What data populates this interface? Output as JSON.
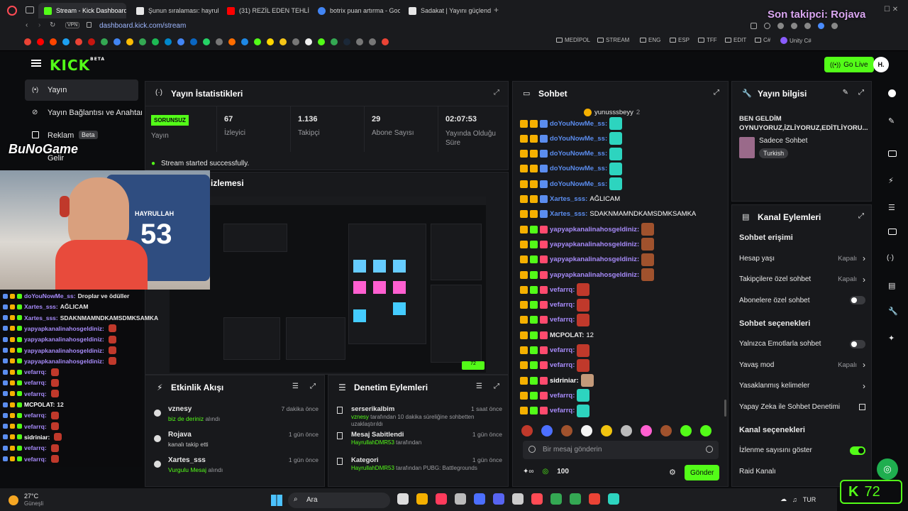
{
  "browser": {
    "tabs": [
      {
        "label": "Stream - Kick Dashboard",
        "color": "#53fc18"
      },
      {
        "label": "Şunun sıralaması: hayrulla...",
        "color": "#e6e6e6"
      },
      {
        "label": "(31) REZİL EDEN TEHLİKE...",
        "color": "#ff0000"
      },
      {
        "label": "botrix puan artırma - Goog...",
        "color": "#4285f4"
      },
      {
        "label": "Sadakat | Yayını güçlendi...",
        "color": "#e6e6e6"
      }
    ],
    "url": "dashboard.kick.com/stream",
    "vpn": "VPN",
    "bookmarks": [
      "MEDİPOL",
      "STREAM",
      "ENG",
      "ESP",
      "TFF",
      "EDIT",
      "C#",
      "Unity C#"
    ]
  },
  "overlay": {
    "last_follower": "Son takipci: Rojava",
    "brand": "BuNoGame",
    "webcam_jersey_name": "HAYRULLAH",
    "webcam_jersey_number": "53",
    "stream_chat": [
      {
        "user": "doYouNowMe_ss:",
        "msg": "Droplar ve ödüller"
      },
      {
        "user": "Xartes_sss:",
        "msg": "AĞLICAM"
      },
      {
        "user": "Xartes_sss:",
        "msg": "SDAKNMAMNDKAMSDMKSAMKA"
      },
      {
        "user": "yapyapkanalinahosgeldiniz:",
        "msg": ""
      },
      {
        "user": "yapyapkanalinahosgeldiniz:",
        "msg": ""
      },
      {
        "user": "yapyapkanalinahosgeldiniz:",
        "msg": ""
      },
      {
        "user": "yapyapkanalinahosgeldiniz:",
        "msg": ""
      },
      {
        "user": "vefarrq:",
        "msg": ""
      },
      {
        "user": "vefarrq:",
        "msg": ""
      },
      {
        "user": "vefarrq:",
        "msg": ""
      },
      {
        "user": "MCPOLAT:",
        "msg": "12"
      },
      {
        "user": "vefarrq:",
        "msg": ""
      },
      {
        "user": "vefarrq:",
        "msg": ""
      },
      {
        "user": "sidriniar:",
        "msg": ""
      },
      {
        "user": "vefarrq:",
        "msg": ""
      },
      {
        "user": "vefarrq:",
        "msg": ""
      }
    ],
    "viewer_count": "72"
  },
  "nav": {
    "items": [
      {
        "label": "Yayın"
      },
      {
        "label": "Yayın Bağlantısı ve Anahtarı"
      },
      {
        "label": "Reklam",
        "badge": "Beta"
      },
      {
        "label": "Gelir"
      }
    ],
    "go_live": "Go Live",
    "avatar": "H."
  },
  "stats": {
    "title": "Yayın İstatistikleri",
    "items": [
      {
        "value": "SORUNSUZ",
        "label": "Yayın"
      },
      {
        "value": "67",
        "label": "İzleyici"
      },
      {
        "value": "1.136",
        "label": "Takipçi"
      },
      {
        "value": "29",
        "label": "Abone Sayısı"
      },
      {
        "value": "02:07:53",
        "label": "Yayında Olduğu Süre"
      }
    ],
    "status_message": "Stream started successfully.",
    "preview_title": "Yayın Önizlemesi",
    "preview_title_visible": "izlemesi"
  },
  "activity": {
    "title": "Etkinlik Akışı",
    "events": [
      {
        "user": "vznesy",
        "desc": "biz de deriniz",
        "suffix": "alındı",
        "time": "7 dakika önce"
      },
      {
        "user": "Rojava",
        "desc": "kanalı takip etti",
        "suffix": "",
        "time": "1 gün önce"
      },
      {
        "user": "Xartes_sss",
        "desc": "Vurgulu Mesaj",
        "suffix": "alındı",
        "time": "1 gün önce"
      }
    ]
  },
  "moderation": {
    "title": "Denetim Eylemleri",
    "events": [
      {
        "title": "serserikalbim",
        "line1": "vznesy",
        "line1b": "tarafından 10 dakika süreliğine sohbetten uzaklaştırıldı",
        "time": "1 saat önce"
      },
      {
        "title": "Mesaj Sabitlendi",
        "line1": "HayrullahDMR53",
        "line1b": "tarafından",
        "time": "1 gün önce"
      },
      {
        "title": "Kategori",
        "line1": "HayrullahDMR53",
        "line1b": "tarafından PUBG: Battlegrounds",
        "time": "1 gün önce"
      }
    ]
  },
  "chat": {
    "title": "Sohbet",
    "pinned_user": "yunusssbeyy",
    "pinned_count": "2",
    "messages": [
      {
        "user": "doYouNowMe_ss:",
        "text": "",
        "color": "#5b8def"
      },
      {
        "user": "doYouNowMe_ss:",
        "text": "",
        "color": "#5b8def"
      },
      {
        "user": "doYouNowMe_ss:",
        "text": "",
        "color": "#5b8def"
      },
      {
        "user": "doYouNowMe_ss:",
        "text": "",
        "color": "#5b8def"
      },
      {
        "user": "doYouNowMe_ss:",
        "text": "",
        "color": "#5b8def"
      },
      {
        "user": "Xartes_sss:",
        "text": "AĞLICAM",
        "color": "#5b8def"
      },
      {
        "user": "Xartes_sss:",
        "text": "SDAKNMAMNDKAMSDMKSAMKA",
        "color": "#5b8def"
      },
      {
        "user": "yapyapkanalinahosgeldiniz:",
        "text": "",
        "color": "#a78bfa"
      },
      {
        "user": "yapyapkanalinahosgeldiniz:",
        "text": "",
        "color": "#a78bfa"
      },
      {
        "user": "yapyapkanalinahosgeldiniz:",
        "text": "",
        "color": "#a78bfa"
      },
      {
        "user": "yapyapkanalinahosgeldiniz:",
        "text": "",
        "color": "#a78bfa"
      },
      {
        "user": "vefarrq:",
        "text": "",
        "color": "#a78bfa"
      },
      {
        "user": "vefarrq:",
        "text": "",
        "color": "#a78bfa"
      },
      {
        "user": "vefarrq:",
        "text": "",
        "color": "#a78bfa"
      },
      {
        "user": "MCPOLAT:",
        "text": "12",
        "color": "#e8e8e8"
      },
      {
        "user": "vefarrq:",
        "text": "",
        "color": "#a78bfa"
      },
      {
        "user": "vefarrq:",
        "text": "",
        "color": "#a78bfa"
      },
      {
        "user": "sidriniar:",
        "text": "",
        "color": "#ffffff"
      },
      {
        "user": "vefarrq:",
        "text": "",
        "color": "#a78bfa"
      },
      {
        "user": "vefarrq:",
        "text": "",
        "color": "#a78bfa"
      }
    ],
    "input_placeholder": "Bir mesaj gönderin",
    "points": "100",
    "send": "Gönder"
  },
  "stream_info": {
    "title": "Yayın bilgisi",
    "stream_title": "BEN GELDİM OYNUYORUZ,İZLİYORUZ,EDİTLİYORU...",
    "tag1": "Sadece Sohbet",
    "tag2": "Turkish"
  },
  "channel_actions": {
    "title": "Kanal Eylemleri",
    "sections": [
      {
        "heading": "Sohbet erişimi",
        "rows": [
          {
            "label": "Hesap yaşı",
            "value": "Kapalı",
            "kind": "chevron"
          },
          {
            "label": "Takipçilere özel sohbet",
            "value": "Kapalı",
            "kind": "chevron"
          },
          {
            "label": "Abonelere özel sohbet",
            "value": "",
            "kind": "toggle-off"
          }
        ]
      },
      {
        "heading": "Sohbet seçenekleri",
        "rows": [
          {
            "label": "Yalnızca Emotlarla sohbet",
            "value": "",
            "kind": "toggle-off"
          },
          {
            "label": "Yavaş mod",
            "value": "Kapalı",
            "kind": "chevron"
          },
          {
            "label": "Yasaklanmış kelimeler",
            "value": "",
            "kind": "chevron"
          },
          {
            "label": "Yapay Zeka ile Sohbet Denetimi",
            "value": "",
            "kind": "external"
          }
        ]
      },
      {
        "heading": "Kanal seçenekleri",
        "rows": [
          {
            "label": "İzlenme sayısını göster",
            "value": "",
            "kind": "toggle-on"
          },
          {
            "label": "Raid Kanalı",
            "value": "",
            "kind": "none"
          }
        ]
      }
    ]
  },
  "taskbar": {
    "weather_temp": "27°C",
    "weather_desc": "Güneşli",
    "search": "Ara",
    "lang": "TUR"
  },
  "colors": {
    "accent": "#53fc18",
    "panel": "#18191c",
    "bg": "#0b0c0e"
  }
}
